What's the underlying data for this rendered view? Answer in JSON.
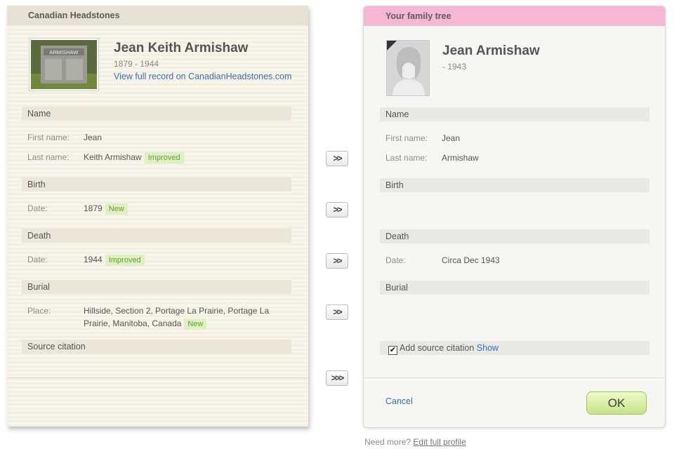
{
  "left": {
    "header": "Canadian Headstones",
    "person": {
      "name": "Jean Keith Armishaw",
      "dates": "1879 - 1944",
      "link": "View full record on CanadianHeadstones.com",
      "photo_text": "ARMISHAW"
    },
    "sections": {
      "name": "Name",
      "birth": "Birth",
      "death": "Death",
      "burial": "Burial",
      "source": "Source citation"
    },
    "labels": {
      "first_name": "First name:",
      "last_name": "Last name:",
      "birth_date": "Date:",
      "death_date": "Date:",
      "place": "Place:"
    },
    "values": {
      "first_name": "Jean",
      "last_name": "Keith Armishaw",
      "birth_date": "1879",
      "death_date": "1944",
      "place": "Hillside, Section 2, Portage La Prairie, Portage La Prairie, Manitoba, Canada"
    },
    "badges": {
      "last_name": "Improved",
      "birth_date": "New",
      "death_date": "Improved",
      "place": "New"
    }
  },
  "arrows": {
    "single": ">>",
    "all": ">>>"
  },
  "right": {
    "header": "Your family tree",
    "person": {
      "name": "Jean Armishaw",
      "dates": "- 1943"
    },
    "sections": {
      "name": "Name",
      "birth": "Birth",
      "death": "Death",
      "burial": "Burial"
    },
    "labels": {
      "first_name": "First name:",
      "last_name": "Last name:",
      "death_date": "Date:"
    },
    "values": {
      "first_name": "Jean",
      "last_name": "Armishaw",
      "death_date": "Circa Dec 1943"
    },
    "source": {
      "checked": true,
      "label": "Add source citation",
      "show_link": "Show"
    },
    "cancel": "Cancel",
    "ok": "OK"
  },
  "footer": {
    "need_more": "Need more?",
    "edit_link": "Edit full profile"
  },
  "colors": {
    "left_header": "#e6e1d3",
    "right_header": "#f6b6d6",
    "link": "#3a6eb0",
    "badge_bg": "#dff0c4",
    "badge_text": "#6a9b34",
    "ok_button": "#c6e38a"
  }
}
